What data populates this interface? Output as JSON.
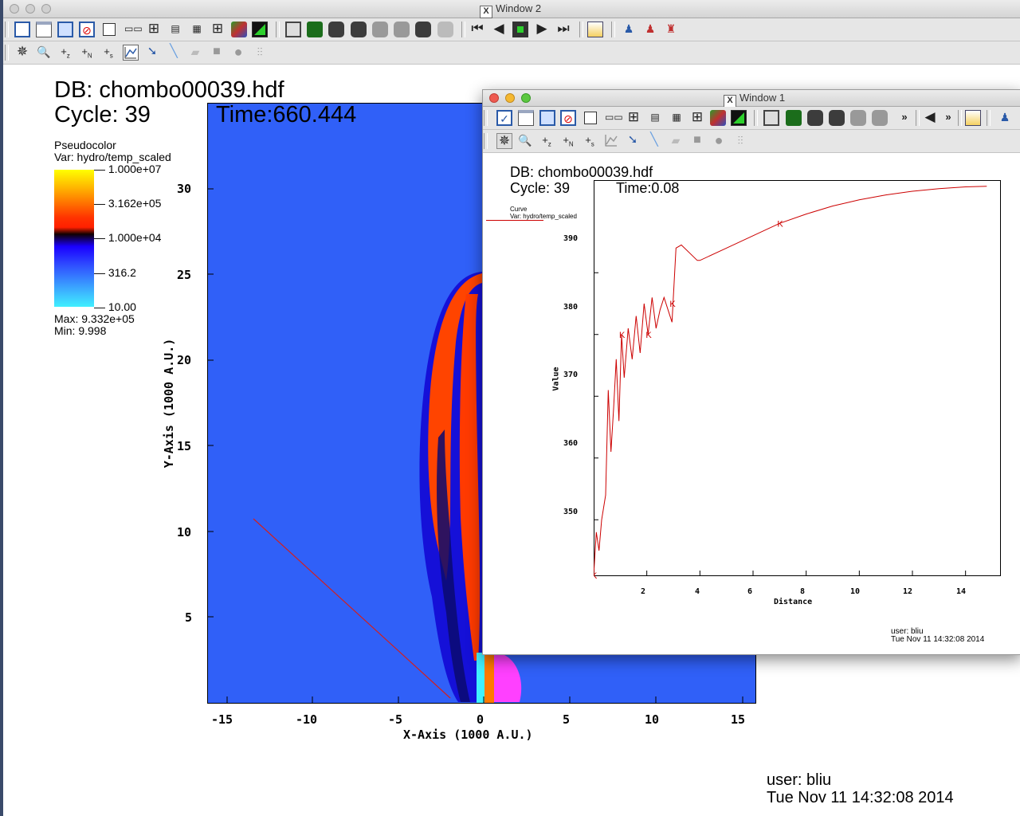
{
  "window2": {
    "title": "Window 2",
    "plot": {
      "db_label": "DB: chombo00039.hdf",
      "cycle_label": "Cycle: 39",
      "time_label": "Time:660.444",
      "legend": {
        "type": "Pseudocolor",
        "var": "Var: hydro/temp_scaled",
        "ticks": [
          "1.000e+07",
          "3.162e+05",
          "1.000e+04",
          "316.2",
          "10.00"
        ],
        "max": "Max:  9.332e+05",
        "min": "Min:  9.998"
      },
      "x_axis_label": "X-Axis (1000 A.U.)",
      "y_axis_label": "Y-Axis (1000 A.U.)",
      "x_ticks": [
        "-15",
        "-10",
        "-5",
        "0",
        "5",
        "10",
        "15"
      ],
      "y_ticks": [
        "30",
        "25",
        "20",
        "15",
        "10",
        "5"
      ],
      "user": "user: bliu",
      "date": "Tue Nov 11 14:32:08 2014"
    }
  },
  "window1": {
    "title": "Window 1",
    "plot": {
      "db_label": "DB: chombo00039.hdf",
      "cycle_label": "Cycle: 39",
      "time_label": "Time:0.08",
      "legend_type": "Curve",
      "legend_var": "Var: hydro/temp_scaled",
      "x_axis_label": "Distance",
      "y_axis_label": "Value",
      "x_ticks": [
        "2",
        "4",
        "6",
        "8",
        "10",
        "12",
        "14"
      ],
      "y_ticks": [
        "390",
        "380",
        "370",
        "360",
        "350"
      ],
      "user": "user: bliu",
      "date": "Tue Nov 11 14:32:08 2014"
    }
  },
  "chart_data": {
    "type": "line",
    "xlabel": "Distance",
    "ylabel": "Value",
    "xlim": [
      0,
      15.3
    ],
    "ylim": [
      341,
      405
    ],
    "color": "#cc0000",
    "x": [
      0,
      0.1,
      0.2,
      0.3,
      0.45,
      0.55,
      0.65,
      0.75,
      0.85,
      0.95,
      1.05,
      1.15,
      1.3,
      1.45,
      1.6,
      1.75,
      1.9,
      2.05,
      2.2,
      2.35,
      2.5,
      2.65,
      2.8,
      2.95,
      3.1,
      3.3,
      3.9,
      4.0,
      5.0,
      6.0,
      7.0,
      8.0,
      9.0,
      10.0,
      11.0,
      12.0,
      13.0,
      14.0,
      14.8
    ],
    "y": [
      341,
      348,
      345,
      350,
      354,
      371,
      361,
      368,
      376,
      366,
      380,
      373,
      381,
      376,
      383,
      377,
      385,
      380,
      386,
      381,
      384,
      386,
      384,
      382,
      394,
      394.5,
      392,
      392,
      394,
      396,
      398,
      399.5,
      400.8,
      401.8,
      402.6,
      403.2,
      403.6,
      403.9,
      404
    ]
  }
}
